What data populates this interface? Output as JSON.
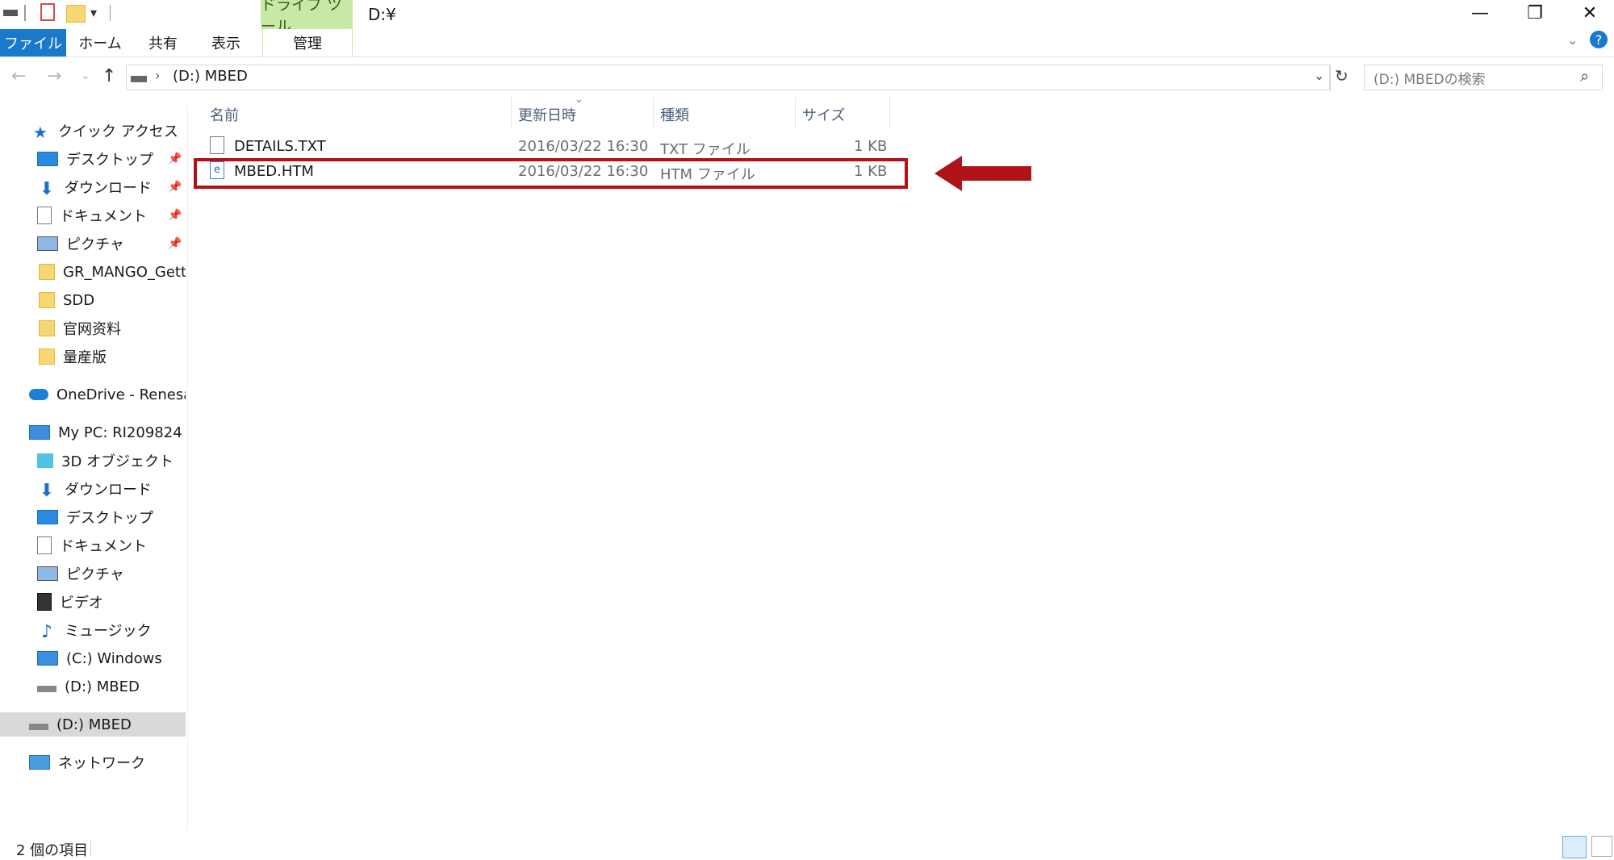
{
  "window": {
    "title": "D:¥",
    "context_tab": "ドライブ ツール",
    "minimize": "—",
    "maximize": "❐",
    "close": "✕"
  },
  "ribbon": {
    "tabs": [
      "ファイル",
      "ホーム",
      "共有",
      "表示",
      "管理"
    ]
  },
  "address": {
    "path": "(D:) MBED",
    "search_placeholder": "(D:) MBEDの検索"
  },
  "sidebar": {
    "items": [
      {
        "label": "クイック アクセス",
        "icon": "star-icon",
        "pinned": false
      },
      {
        "label": "デスクトップ",
        "icon": "desktop-icon",
        "pinned": true
      },
      {
        "label": "ダウンロード",
        "icon": "download-icon",
        "pinned": true
      },
      {
        "label": "ドキュメント",
        "icon": "document-icon",
        "pinned": true
      },
      {
        "label": "ピクチャ",
        "icon": "pictures-icon",
        "pinned": true
      },
      {
        "label": "GR_MANGO_Gettin",
        "icon": "folder-icon",
        "pinned": false
      },
      {
        "label": "SDD",
        "icon": "folder-icon",
        "pinned": false
      },
      {
        "label": "官网资料",
        "icon": "folder-icon",
        "pinned": false
      },
      {
        "label": "量産版",
        "icon": "folder-icon",
        "pinned": false
      },
      {
        "label": "OneDrive - Renesas E",
        "icon": "onedrive-icon",
        "pinned": false
      },
      {
        "label": "My PC: RI209824",
        "icon": "pc-icon",
        "pinned": false
      },
      {
        "label": "3D オブジェクト",
        "icon": "3d-objects-icon",
        "pinned": false
      },
      {
        "label": "ダウンロード",
        "icon": "download-icon",
        "pinned": false
      },
      {
        "label": "デスクトップ",
        "icon": "desktop-icon",
        "pinned": false
      },
      {
        "label": "ドキュメント",
        "icon": "document-icon",
        "pinned": false
      },
      {
        "label": "ピクチャ",
        "icon": "pictures-icon",
        "pinned": false
      },
      {
        "label": "ビデオ",
        "icon": "video-icon",
        "pinned": false
      },
      {
        "label": "ミュージック",
        "icon": "music-icon",
        "pinned": false
      },
      {
        "label": "(C:) Windows",
        "icon": "windows-drive-icon",
        "pinned": false
      },
      {
        "label": "(D:) MBED",
        "icon": "drive-icon",
        "pinned": false
      },
      {
        "label": "(D:) MBED",
        "icon": "drive-icon",
        "pinned": false,
        "selected": true
      },
      {
        "label": "ネットワーク",
        "icon": "network-icon",
        "pinned": false
      }
    ]
  },
  "columns": [
    "名前",
    "更新日時",
    "種類",
    "サイズ"
  ],
  "files": [
    {
      "name": "DETAILS.TXT",
      "modified": "2016/03/22 16:30",
      "type": "TXT ファイル",
      "size": "1 KB",
      "icon": "text-file-icon"
    },
    {
      "name": "MBED.HTM",
      "modified": "2016/03/22 16:30",
      "type": "HTM ファイル",
      "size": "1 KB",
      "icon": "html-file-icon"
    }
  ],
  "status": {
    "item_count": "2 個の項目"
  },
  "colors": {
    "file_tab": "#1979ca",
    "context_tab": "#c8e8a6",
    "highlight": "#b01217"
  }
}
